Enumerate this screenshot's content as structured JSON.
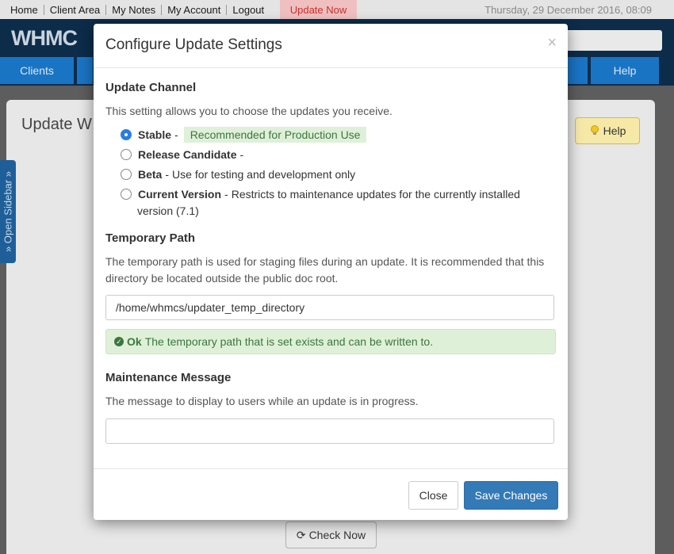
{
  "topbar": {
    "links": [
      "Home",
      "Client Area",
      "My Notes",
      "My Account",
      "Logout"
    ],
    "update_now": "Update Now",
    "date": "Thursday, 29 December 2016, 08:09"
  },
  "header": {
    "logo": "WHMC"
  },
  "nav": {
    "clients": "Clients",
    "help": "Help"
  },
  "page": {
    "title": "Update W",
    "help_button": "Help",
    "open_sidebar": "» Open Sidebar »",
    "check_now": "Check Now"
  },
  "modal": {
    "title": "Configure Update Settings",
    "close_symbol": "×",
    "update_channel": {
      "heading": "Update Channel",
      "description": "This setting allows you to choose the updates you receive.",
      "options": [
        {
          "label": "Stable",
          "sep": "-",
          "text": "Recommended for Production Use",
          "selected": true
        },
        {
          "label": "Release Candidate",
          "sep": "-",
          "text": "",
          "selected": false
        },
        {
          "label": "Beta",
          "sep": "-",
          "text": "Use for testing and development only",
          "selected": false
        },
        {
          "label": "Current Version",
          "sep": "-",
          "text": "Restricts to maintenance updates for the currently installed",
          "text_line2": "version (7.1)",
          "selected": false
        }
      ]
    },
    "temporary_path": {
      "heading": "Temporary Path",
      "description": "The temporary path is used for staging files during an update. It is recommended that this directory be located outside the public doc root.",
      "value": "/home/whmcs/updater_temp_directory",
      "status_label": "Ok",
      "status_text": "The temporary path that is set exists and can be written to."
    },
    "maintenance_message": {
      "heading": "Maintenance Message",
      "description": "The message to display to users while an update is in progress.",
      "value": ""
    },
    "buttons": {
      "close": "Close",
      "save": "Save Changes"
    }
  },
  "colors": {
    "primary": "#337ab7",
    "success_bg": "#dff0d8",
    "success_text": "#3c763d",
    "header_bg": "#0c2c4a",
    "nav_bg": "#1a74c4"
  }
}
